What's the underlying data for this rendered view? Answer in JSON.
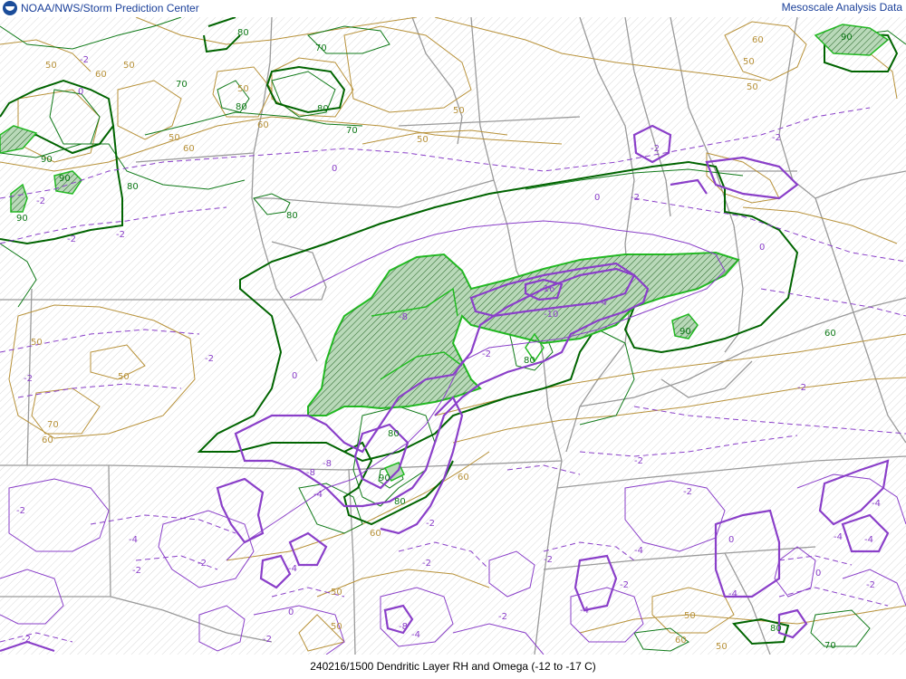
{
  "header": {
    "org_text": "NOAA/NWS/Storm Prediction Center",
    "product_text": "Mesoscale Analysis Data",
    "logo_icon": "noaa-logo-icon"
  },
  "caption": "240216/1500 Dendritic Layer RH and Omega (-12 to -17 C)",
  "map_labels": {
    "rh_green": [
      "70",
      "80",
      "70",
      "80",
      "90",
      "80",
      "70",
      "80",
      "90",
      "80",
      "60",
      "90",
      "80",
      "80",
      "90",
      "70",
      "80",
      "80",
      "90",
      "90"
    ],
    "rh_tan": [
      "50",
      "60",
      "50",
      "60",
      "50",
      "60",
      "50",
      "50",
      "50",
      "50",
      "50",
      "50",
      "60",
      "60",
      "50",
      "60",
      "60",
      "50",
      "50",
      "60",
      "70",
      "50",
      "50"
    ],
    "omega_purple": [
      "-2",
      "0",
      "0",
      "-2",
      "-2",
      "-2",
      "0",
      "-2",
      "0",
      "-8",
      "-16",
      "-10",
      "-4",
      "-2",
      "0",
      "-2",
      "-8",
      "-4",
      "-2",
      "-4",
      "-2",
      "-2",
      "-2",
      "-4",
      "-2",
      "-2",
      "-4",
      "-8",
      "-4",
      "-8",
      "-2",
      "-2",
      "-4",
      "0",
      "-4",
      "-4",
      "-4",
      "0",
      "-4",
      "-2",
      "-2",
      "-2",
      "-2",
      "0",
      "-2",
      "-2",
      "-2",
      "-2",
      "-2"
    ]
  },
  "colors": {
    "background": "#ffffff",
    "hatch": "#c9c9c9",
    "state_lines": "#9a9a9a",
    "rh_green": "#0f7a18",
    "rh_dark_green": "#006400",
    "rh_bright_green": "#22bb22",
    "rh_fill": "#b9d9b9",
    "rh_tan": "#b8923a",
    "omega_purple": "#8a3fc9",
    "omega_dark": "#6a1aa6",
    "header_text": "#1a3f99",
    "caption_text": "#000000"
  }
}
